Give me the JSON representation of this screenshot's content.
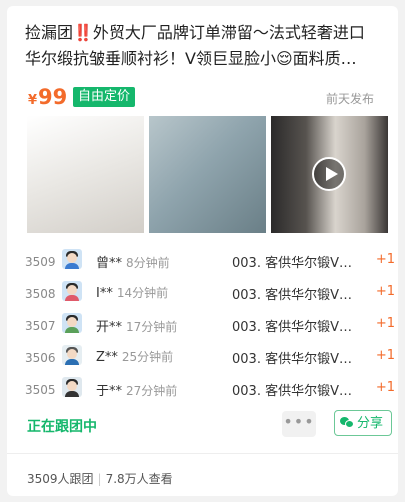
{
  "post": {
    "title_line1": "捡漏团‼️外贸大厂品牌订单滞留～法式轻奢进口",
    "title_line2": "华尔缎抗皱垂顺衬衫！V领巨显脸小😌面料质…",
    "price_symbol": "¥",
    "price": "99",
    "price_tag": "自由定价",
    "published": "前天发布"
  },
  "orders": [
    {
      "number": "3509",
      "name": "曾**",
      "time": "8分钟前",
      "item": "003. 客供华尔锻V…",
      "qty": "+1"
    },
    {
      "number": "3508",
      "name": "I**",
      "time": "14分钟前",
      "item": "003. 客供华尔锻V…",
      "qty": "+1"
    },
    {
      "number": "3507",
      "name": "开**",
      "time": "17分钟前",
      "item": "003. 客供华尔锻V…",
      "qty": "+1"
    },
    {
      "number": "3506",
      "name": "Z**",
      "time": "25分钟前",
      "item": "003. 客供华尔锻V…",
      "qty": "+1"
    },
    {
      "number": "3505",
      "name": "于**",
      "time": "27分钟前",
      "item": "003. 客供华尔锻V…",
      "qty": "+1"
    }
  ],
  "actions": {
    "status": "正在跟团中",
    "more": "•••",
    "share": "分享"
  },
  "stats": {
    "followers": "3509人跟团",
    "views": "7.8万人查看"
  },
  "colors": {
    "accent_green": "#15b76c",
    "price_orange": "#f36b2b"
  }
}
